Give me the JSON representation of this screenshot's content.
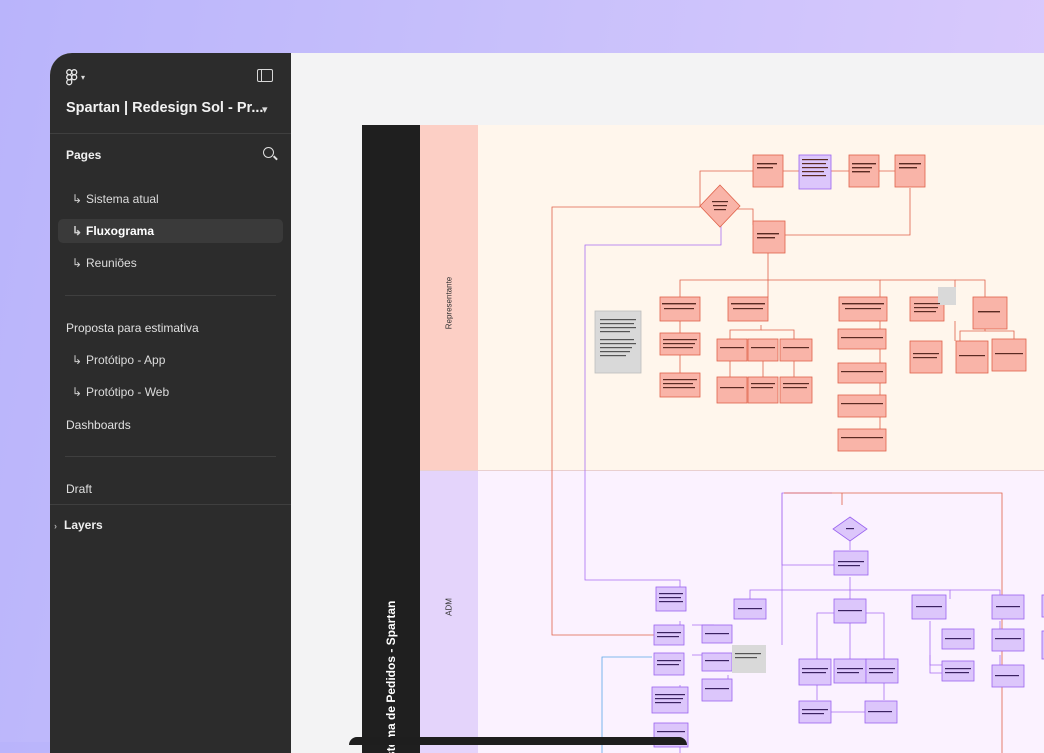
{
  "sidebar": {
    "file_title": "Spartan | Redesign Sol - Pr...",
    "pages_title": "Pages",
    "pages": [
      {
        "label": "Sistema atual",
        "arrow": "↳"
      },
      {
        "label": "Fluxograma",
        "arrow": "↳",
        "active": true
      },
      {
        "label": "Reuniões",
        "arrow": "↳"
      }
    ],
    "proposal_title": "Proposta para estimativa",
    "proposal_pages": [
      {
        "label": "Protótipo - App",
        "arrow": "↳"
      },
      {
        "label": "Protótipo - Web",
        "arrow": "↳"
      }
    ],
    "dashboards": "Dashboards",
    "draft": "Draft",
    "layers": "Layers",
    "icons": [
      "figma-logo-icon",
      "chevron-down-icon",
      "panel-toggle-icon",
      "search-icon"
    ]
  },
  "board": {
    "title": "Sistema de Pedidos - Spartan",
    "lanes": [
      {
        "name": "Representante",
        "color": "#fccfc5",
        "body_color": "#fff6ec"
      },
      {
        "name": "ADM",
        "color": "#e4d4fb",
        "body_color": "#fbf2ff"
      }
    ],
    "colors": {
      "rep_node": "#f9b4a8",
      "rep_stroke": "#e0624a",
      "adm_node": "#dcc6fb",
      "adm_stroke": "#9a63f0",
      "note": "#d9d9d9"
    }
  }
}
